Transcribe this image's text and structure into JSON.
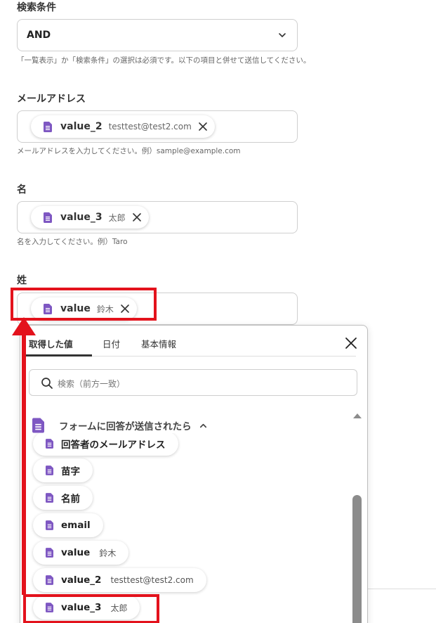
{
  "search_condition": {
    "label": "検索条件",
    "value": "AND",
    "help": "「一覧表示」か「検索条件」の選択は必須です。以下の項目と併せて送信してください。"
  },
  "email_field": {
    "label": "メールアドレス",
    "chip_name": "value_2",
    "chip_value": "testtest@test2.com",
    "help": "メールアドレスを入力してください。例）sample@example.com"
  },
  "first_name_field": {
    "label": "名",
    "chip_name": "value_3",
    "chip_value": "太郎",
    "help": "名を入力してください。例）Taro"
  },
  "last_name_field": {
    "label": "姓",
    "chip_name": "value",
    "chip_value": "鈴木"
  },
  "popup": {
    "tabs": [
      "取得した値",
      "日付",
      "基本情報"
    ],
    "active_tab": "取得した値",
    "search_placeholder": "検索（前方一致）",
    "group_label": "フォームに回答が送信されたら",
    "items": [
      {
        "name": "回答者のメールアドレス",
        "value": ""
      },
      {
        "name": "苗字",
        "value": ""
      },
      {
        "name": "名前",
        "value": ""
      },
      {
        "name": "email",
        "value": ""
      },
      {
        "name": "value",
        "value": "鈴木"
      },
      {
        "name": "value_2",
        "value": "testtest@test2.com"
      },
      {
        "name": "value_3",
        "value": "太郎"
      }
    ]
  },
  "icons": {
    "doc": "form-doc-icon",
    "close": "close-icon",
    "search": "search-icon",
    "chevron_down": "chevron-down-icon",
    "chevron_up": "chevron-up-icon"
  },
  "colors": {
    "accent_purple": "#7e57c2",
    "highlight_red": "#e3121c"
  }
}
